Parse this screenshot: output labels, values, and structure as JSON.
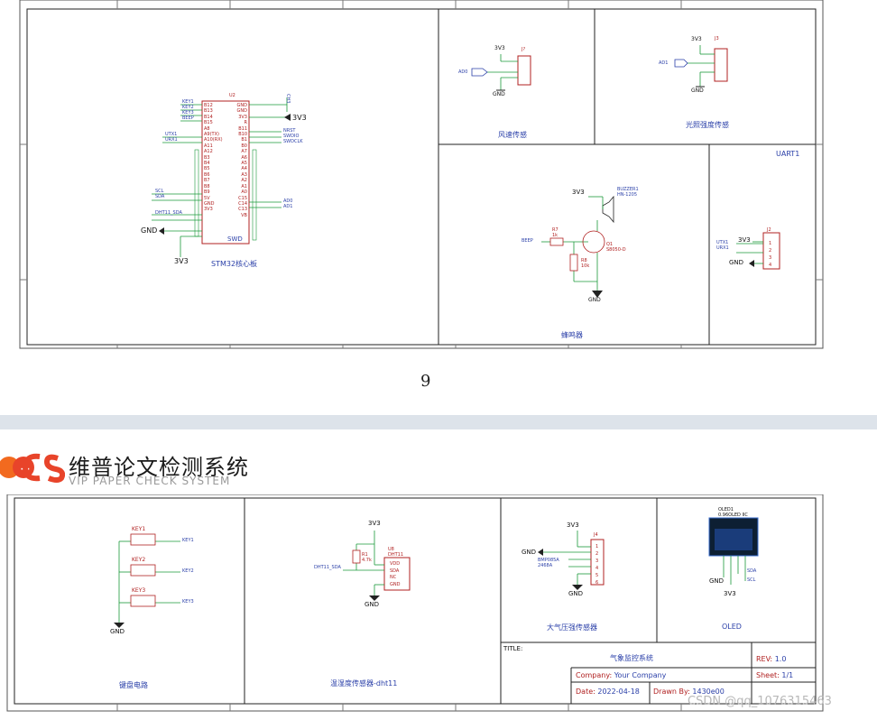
{
  "top_sheet": {
    "mcu": {
      "ref": "U2",
      "name": "STM32核心板",
      "left_pins": [
        "B12",
        "B13",
        "B14",
        "B15",
        "A8",
        "A9(TX)",
        "A10(RX)",
        "A11",
        "A12",
        "B3",
        "B4",
        "B5",
        "B6",
        "B7",
        "B8",
        "B9",
        "5V",
        "GND",
        "3V3"
      ],
      "right_pins": [
        "GND",
        "GND",
        "3V3",
        "R",
        "B11",
        "B10",
        "B1",
        "B0",
        "A7",
        "A6",
        "A5",
        "A4",
        "A3",
        "A2",
        "A1",
        "A0",
        "C15",
        "C14",
        "C13",
        "VB"
      ],
      "left_nets": [
        "KEY1",
        "KEY2",
        "KEY3",
        "BEEP",
        "UTX1",
        "URX1",
        "SCL",
        "SDA",
        "DHT11_SDA",
        "GND",
        "3V3"
      ],
      "right_nets": [
        "CH3",
        "3V3",
        "NRST",
        "SWDIO",
        "SWDCLK",
        "AD0",
        "AD1"
      ],
      "swd": "SWD",
      "gnd_label": "GND",
      "v_label": "3V3"
    },
    "wind": {
      "ref": "J?",
      "net": "AD0",
      "power": "3V3",
      "gnd": "GND",
      "title": "风速传感"
    },
    "uv": {
      "ref": "J3",
      "net": "AD1",
      "power": "3V3",
      "gnd": "GND",
      "title": "光照强度传感"
    },
    "buzzer": {
      "title": "蜂鸣器",
      "part": "BUZZER1",
      "model": "HN-1205",
      "resistor": "R7",
      "r_val": "1k",
      "r2": "R8",
      "r2_val": "10k",
      "transistor": "Q1",
      "t_model": "S8050-D",
      "net": "BEEP",
      "power": "3V3",
      "gnd": "GND"
    },
    "uart": {
      "title": "UART1",
      "ref": "J2",
      "nets": [
        "UTX1",
        "URX1"
      ],
      "power": "3V3",
      "gnd": "GND",
      "pins": [
        "1",
        "2",
        "3",
        "4"
      ]
    },
    "page_number": "9"
  },
  "logo": {
    "mark": "CS",
    "cn": "维普论文检测系统",
    "en": "VIP PAPER CHECK SYSTEM"
  },
  "bottom_sheet": {
    "keys": {
      "title": "键盘电路",
      "items": [
        "KEY1",
        "KEY2",
        "KEY3"
      ],
      "gnd": "GND"
    },
    "dht": {
      "title": "温湿度传感器-dht11",
      "ref": "U8",
      "part": "DHT11",
      "net": "DHT11_SDA",
      "r_ref": "R1",
      "r_val": "4.7k",
      "pins": [
        "VDD",
        "SDA",
        "NC",
        "GND"
      ],
      "power": "3V3",
      "gnd": "GND"
    },
    "baro": {
      "title": "大气压强传感器",
      "ref": "J4",
      "pins": [
        "1",
        "2",
        "3",
        "4",
        "5",
        "6"
      ],
      "nets": [
        "BMP085A",
        "2468A"
      ],
      "power": "3V3",
      "gnd": "GND"
    },
    "oled": {
      "title": "OLED",
      "ref": "OLED1",
      "model": "0.96OLED IIC",
      "gnd": "GND",
      "sda": "SDA",
      "scl": "SCL",
      "power": "3V3"
    },
    "titleblock": {
      "title_label": "TITLE:",
      "title_value": "气象监控系统",
      "rev_label": "REV:",
      "rev_value": "1.0",
      "company_label": "Company:",
      "company_value": "Your Company",
      "sheet_label": "Sheet:",
      "sheet_value": "1/1",
      "date_label": "Date:",
      "date_value": "2022-04-18",
      "drawn_label": "Drawn By:",
      "drawn_value": "1430e00"
    }
  },
  "watermark": "CSDN @qq_1076315463",
  "colors": {
    "wire": "#1a9a3a",
    "label": "#2a3fa8",
    "part": "#b02020",
    "frame": "#222222"
  }
}
